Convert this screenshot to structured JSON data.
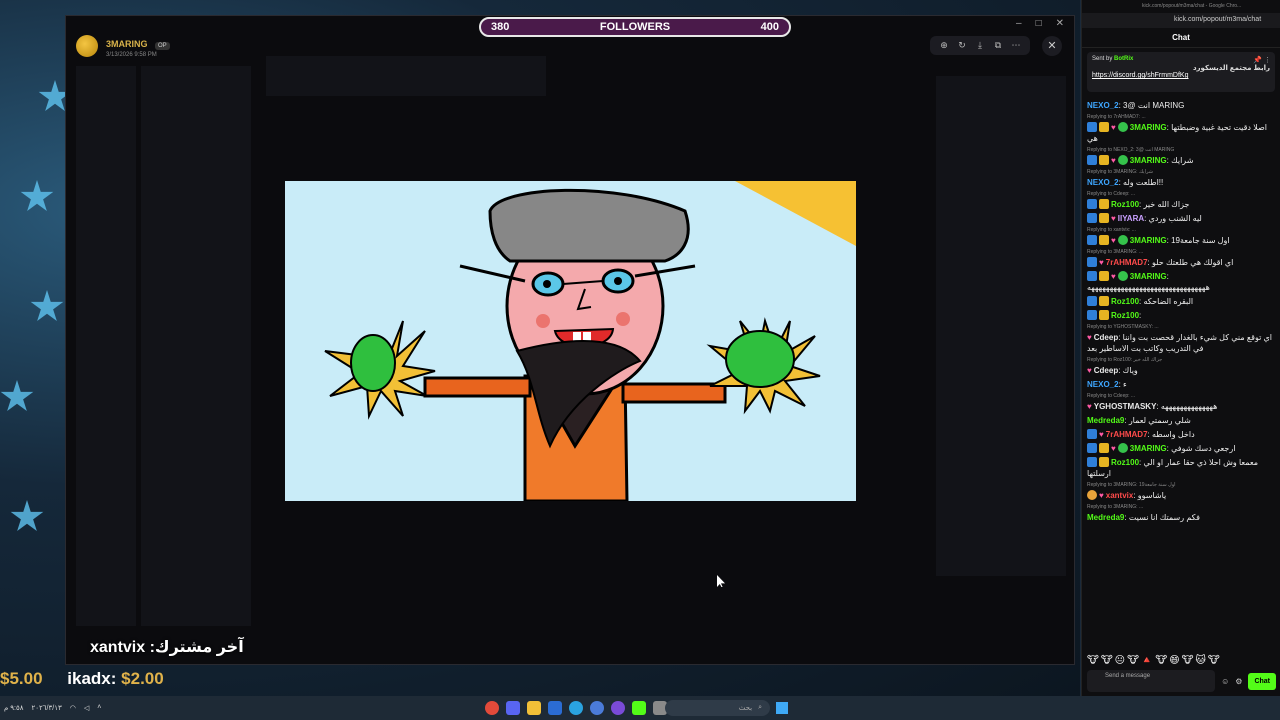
{
  "followers": {
    "current": "380",
    "label": "FOLLOWERS",
    "goal": "400",
    "progress": 0.0
  },
  "discord": {
    "poster_name": "3MARING",
    "poster_tag": "OP",
    "timestamp": "3/13/2026 9:58 PM",
    "tools": [
      "zoom-icon",
      "rotate-icon",
      "download-icon",
      "open-icon",
      "more-icon"
    ]
  },
  "overlay": {
    "last_subscriber": "xantvix :آخر مشترك",
    "donations": [
      {
        "amount": "$5.00"
      },
      {
        "user": "ikadx:",
        "amount": "$2.00"
      }
    ]
  },
  "chat": {
    "window_title": "kick.com/popout/m3ma/chat - Google Chro...",
    "url": "kick.com/popout/m3ma/chat",
    "title": "Chat",
    "pinned": {
      "sent_by_label": "Sent by",
      "bot_name": "BotRix",
      "text": "رابط مجتمع الديسكورد",
      "link": "https://discord.gg/shFrmmDfKg"
    },
    "messages": [
      {
        "reply": "",
        "user": "NEXO_2",
        "color": "#3ea6ff",
        "badges": [],
        "text": "3@ انت MARING"
      },
      {
        "reply": "Replying to 7rAHMAD7: ...",
        "user": "3MARING",
        "color": "#53fc18",
        "badges": [
          "blue",
          "gold",
          "heart",
          "green"
        ],
        "text": "اصلا دقيت تحية غبية وضبطتها هي"
      },
      {
        "reply": "Replying to NEXO_2: 3@ انت MARING",
        "user": "3MARING",
        "color": "#53fc18",
        "badges": [
          "blue",
          "gold",
          "heart",
          "green"
        ],
        "text": "شرايك"
      },
      {
        "reply": "Replying to 3MARING: شرايك",
        "user": "NEXO_2",
        "color": "#3ea6ff",
        "badges": [],
        "text": "اطلعت وله!!"
      },
      {
        "reply": "Replying to Cdeep: ...",
        "user": "Roz100",
        "color": "#53fc18",
        "badges": [
          "blue",
          "gold"
        ],
        "text": "جزاك الله خير"
      },
      {
        "reply": "",
        "user": "IIYARA",
        "color": "#c9a0ff",
        "badges": [
          "blue",
          "gold",
          "heart"
        ],
        "text": "ليه الشنب وردي"
      },
      {
        "reply": "Replying to xantvix: ...",
        "user": "3MARING",
        "color": "#53fc18",
        "badges": [
          "blue",
          "gold",
          "heart",
          "green"
        ],
        "text": "اول سنة جامعة19"
      },
      {
        "reply": "Replying to 3MARING: ...",
        "user": "7rAHMAD7",
        "color": "#ff4b4b",
        "badges": [
          "blue",
          "heart"
        ],
        "text": "اي اقولك هي طلعتك حلو"
      },
      {
        "reply": "",
        "user": "3MARING",
        "color": "#53fc18",
        "badges": [
          "blue",
          "gold",
          "heart",
          "green"
        ],
        "text": "ههههههههههههههههههههههههههههههههه"
      },
      {
        "reply": "",
        "user": "Roz100",
        "color": "#53fc18",
        "badges": [
          "blue",
          "gold"
        ],
        "text": "البقره الضاحكه"
      },
      {
        "reply": "",
        "user": "Roz100",
        "color": "#53fc18",
        "badges": [
          "blue",
          "gold"
        ],
        "text": ""
      },
      {
        "reply": "Replying to YGHOSTMASKY: ...",
        "user": "Cdeep",
        "color": "#e8e8e8",
        "badges": [
          "heart"
        ],
        "text": "اي توقع مني كل شيء بالغدار قحصت بت واننا في التدريب وكاتب بت الاساطير بعد"
      },
      {
        "reply": "Replying to Roz100: جزاك الله خير",
        "user": "Cdeep",
        "color": "#e8e8e8",
        "badges": [
          "heart"
        ],
        "text": "وياك"
      },
      {
        "reply": "",
        "user": "NEXO_2",
        "color": "#3ea6ff",
        "badges": [],
        "text": "ء"
      },
      {
        "reply": "Replying to Cdeep: ...",
        "user": "YGHOSTMASKY",
        "color": "#e8e8e8",
        "badges": [
          "heart"
        ],
        "text": "ههههههههههههههه"
      },
      {
        "reply": "",
        "user": "Medreda9",
        "color": "#53fc18",
        "badges": [],
        "text": "شلي رسمتي لعمار"
      },
      {
        "reply": "",
        "user": "7rAHMAD7",
        "color": "#ff4b4b",
        "badges": [
          "blue",
          "heart"
        ],
        "text": "داخل واسطه"
      },
      {
        "reply": "",
        "user": "3MARING",
        "color": "#53fc18",
        "badges": [
          "blue",
          "gold",
          "heart",
          "green"
        ],
        "text": "ارجعي دسك شوفي"
      },
      {
        "reply": "",
        "user": "Roz100",
        "color": "#53fc18",
        "badges": [
          "blue",
          "gold"
        ],
        "text": "معمعا وش احلا ذي حقا عمار او الي ارسلتها"
      },
      {
        "reply": "Replying to 3MARING: اول سنة جامعة19",
        "user": "xantvix",
        "color": "#ff4b4b",
        "badges": [
          "orange",
          "heart"
        ],
        "text": "ياشاسوو"
      },
      {
        "reply": "Replying to 3MARING: ...",
        "user": "Medreda9",
        "color": "#53fc18",
        "badges": [],
        "text": "فكم رسمتك انا نسيت"
      }
    ],
    "input_placeholder": "Send a message",
    "send_label": "Chat"
  },
  "taskbar": {
    "search_placeholder": "بحث",
    "time": "٩:٥٨ م",
    "date": "٢٠٢٦/٣/١٣"
  },
  "colors": {
    "kick_green": "#53fc18",
    "follower_purple": "#7a1f74"
  }
}
